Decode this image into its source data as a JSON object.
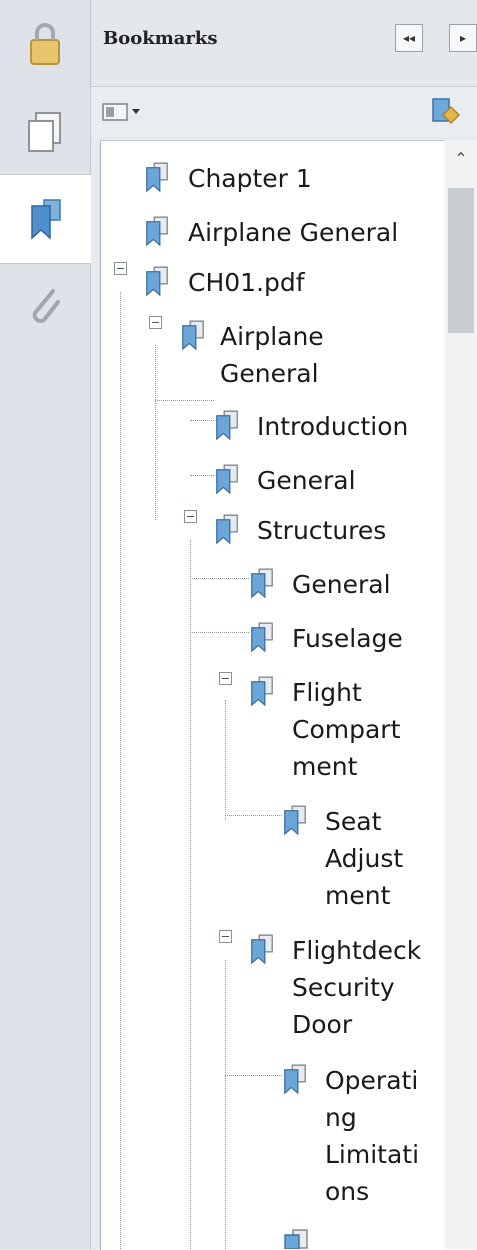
{
  "panel": {
    "title": "Bookmarks",
    "collapse_label": "◂◂",
    "expand_label": "▸"
  },
  "left_rail": {
    "icons": [
      "lock-icon",
      "pages-icon",
      "bookmarks-icon",
      "attachment-icon"
    ]
  },
  "tree": {
    "items": [
      {
        "lines": [
          "Chapter 1"
        ]
      },
      {
        "lines": [
          "Airplane General"
        ]
      },
      {
        "lines": [
          "CH01.pdf"
        ]
      },
      {
        "lines": [
          "Airplane",
          "General"
        ]
      },
      {
        "lines": [
          "Introduction"
        ]
      },
      {
        "lines": [
          "General"
        ]
      },
      {
        "lines": [
          "Structures"
        ]
      },
      {
        "lines": [
          "General"
        ]
      },
      {
        "lines": [
          "Fuselage"
        ]
      },
      {
        "lines": [
          "Flight",
          "Compart",
          "ment"
        ]
      },
      {
        "lines": [
          "Seat",
          "Adjust",
          "ment"
        ]
      },
      {
        "lines": [
          "Flightdeck",
          "Security",
          "Door"
        ]
      },
      {
        "lines": [
          "Operati",
          "ng",
          "Limitati",
          "ons"
        ]
      }
    ]
  },
  "colors": {
    "accent": "#4a90c8",
    "icon_blue": "#6ba6d8"
  }
}
